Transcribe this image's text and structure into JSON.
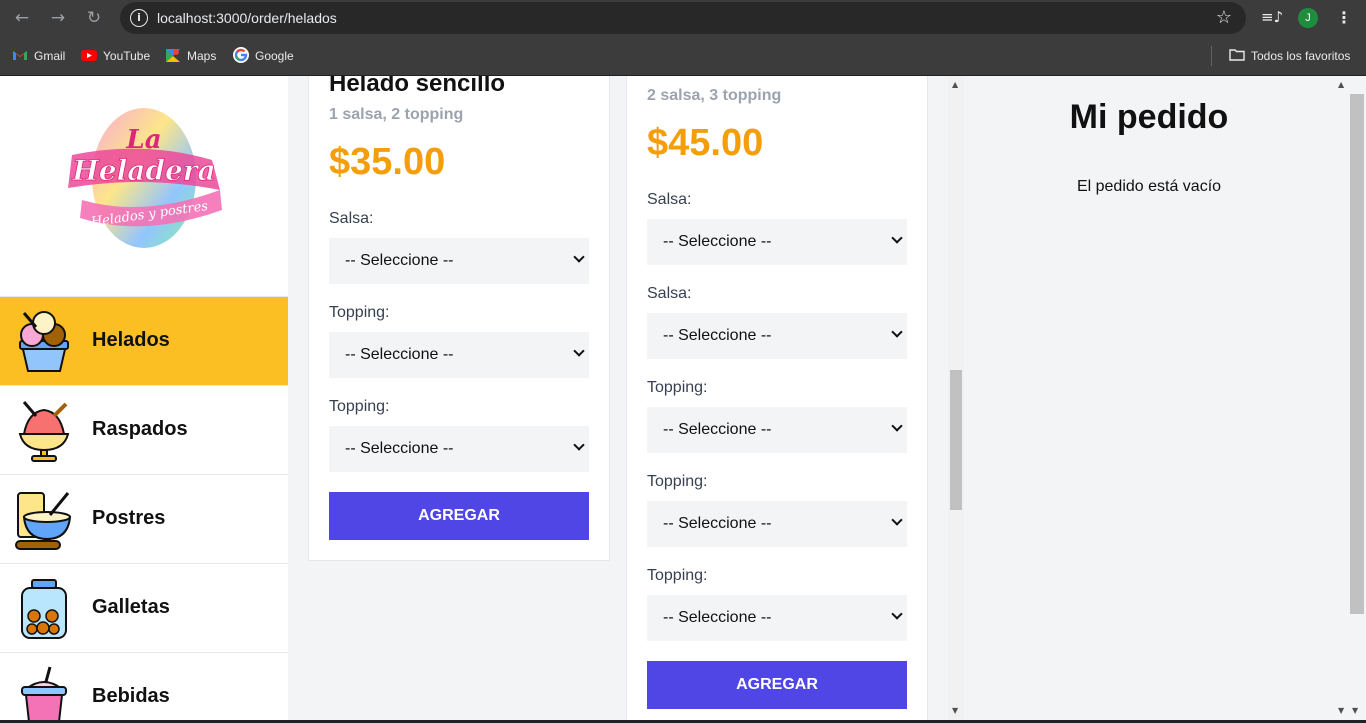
{
  "browser": {
    "url": "localhost:3000/order/helados",
    "back_icon": "←",
    "forward_icon": "→",
    "reload_icon": "↻",
    "star_icon": "☆",
    "media_icon": "≡♪",
    "profile_initial": "J",
    "menu_icon": "⋮",
    "bookmarks": [
      {
        "label": "Gmail",
        "icon": "gmail-icon"
      },
      {
        "label": "YouTube",
        "icon": "youtube-icon"
      },
      {
        "label": "Maps",
        "icon": "maps-icon"
      },
      {
        "label": "Google",
        "icon": "google-icon"
      }
    ],
    "all_bookmarks": "Todos los favoritos"
  },
  "sidebar": {
    "logo_text": "La Heladera",
    "logo_subtext": "Helados y postres",
    "categories": [
      {
        "label": "Helados",
        "icon": "ice-cream-icon",
        "active": true
      },
      {
        "label": "Raspados",
        "icon": "shaved-ice-icon",
        "active": false
      },
      {
        "label": "Postres",
        "icon": "dessert-icon",
        "active": false
      },
      {
        "label": "Galletas",
        "icon": "cookie-jar-icon",
        "active": false
      },
      {
        "label": "Bebidas",
        "icon": "drink-icon",
        "active": false
      }
    ]
  },
  "products": [
    {
      "name": "Helado sencillo",
      "description": "1 salsa, 2 topping",
      "price": "$35.00",
      "fields": [
        {
          "label": "Salsa:",
          "value": "-- Seleccione --"
        },
        {
          "label": "Topping:",
          "value": "-- Seleccione --"
        },
        {
          "label": "Topping:",
          "value": "-- Seleccione --"
        }
      ],
      "button": "AGREGAR"
    },
    {
      "description": "2 salsa, 3 topping",
      "price": "$45.00",
      "fields": [
        {
          "label": "Salsa:",
          "value": "-- Seleccione --"
        },
        {
          "label": "Salsa:",
          "value": "-- Seleccione --"
        },
        {
          "label": "Topping:",
          "value": "-- Seleccione --"
        },
        {
          "label": "Topping:",
          "value": "-- Seleccione --"
        },
        {
          "label": "Topping:",
          "value": "-- Seleccione --"
        }
      ],
      "button": "AGREGAR"
    }
  ],
  "order": {
    "title": "Mi pedido",
    "empty_text": "El pedido está vacío"
  },
  "colors": {
    "accent": "#4f46e5",
    "price": "#f59e0b",
    "active_category": "#fbbf24"
  }
}
